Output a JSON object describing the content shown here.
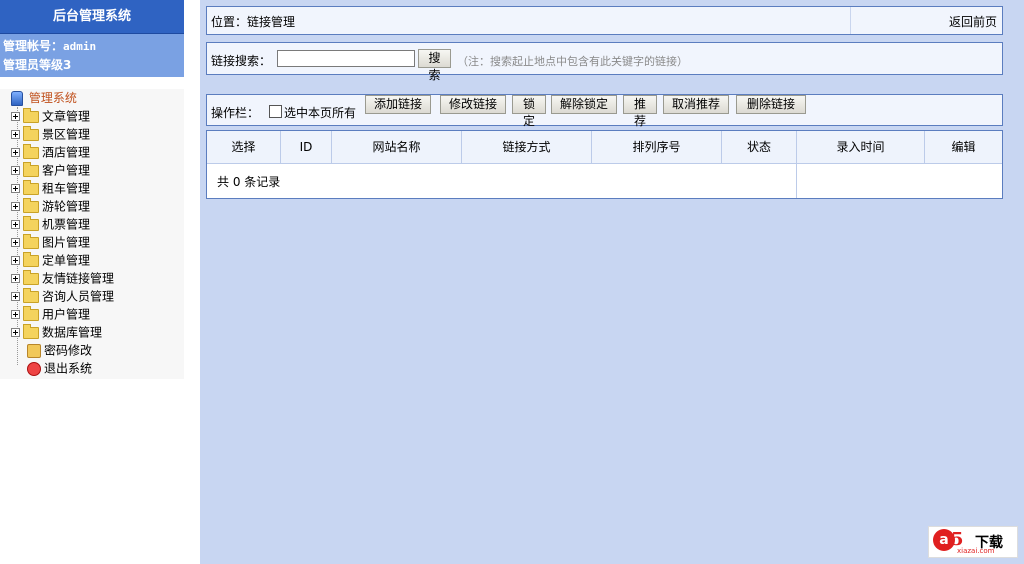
{
  "sidebar": {
    "title": "后台管理系统",
    "admin_account": "管理帐号：",
    "admin_name": "admin",
    "admin_level": "管理员等级3",
    "root": "管理系统",
    "items": [
      {
        "label": "文章管理"
      },
      {
        "label": "景区管理"
      },
      {
        "label": "酒店管理"
      },
      {
        "label": "客户管理"
      },
      {
        "label": "租车管理"
      },
      {
        "label": "游轮管理"
      },
      {
        "label": "机票管理"
      },
      {
        "label": "图片管理"
      },
      {
        "label": "定单管理"
      },
      {
        "label": "友情链接管理"
      },
      {
        "label": "咨询人员管理"
      },
      {
        "label": "用户管理"
      },
      {
        "label": "数据库管理"
      }
    ],
    "password_change": "密码修改",
    "logout": "退出系统"
  },
  "location": {
    "text": "位置：链接管理",
    "back": "返回前页"
  },
  "search": {
    "label": "链接搜索：",
    "value": "",
    "button": "搜索",
    "note": "（注：搜索起止地点中包含有此关键字的链接）"
  },
  "operations": {
    "label": "操作栏：",
    "select_all": "选中本页所有",
    "buttons": [
      "添加链接",
      "修改链接",
      "锁定",
      "解除锁定",
      "推荐",
      "取消推荐",
      "删除链接"
    ]
  },
  "table": {
    "headers": [
      "选择",
      "ID",
      "网站名称",
      "链接方式",
      "排列序号",
      "状态",
      "录入时间",
      "编辑"
    ],
    "total": "共 0 条记录"
  },
  "watermark": {
    "letter": "a",
    "digit": "5",
    "text": "下载",
    "url": "xiazai.com"
  },
  "colors": {
    "sidebar_header": "#2f63c2",
    "admin_bar": "#7aa1e3",
    "main_bg": "#c8d6f2",
    "panel_border": "#5b7dbf",
    "root_label": "#c0501c"
  }
}
